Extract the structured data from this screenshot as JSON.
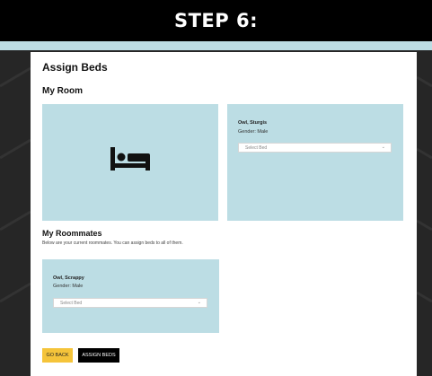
{
  "banner": {
    "title": "STEP 6:"
  },
  "page": {
    "title": "Assign Beds",
    "my_room_label": "My Room"
  },
  "my_room": {
    "bed_icon": "bed-icon",
    "occupant": {
      "name": "Owl, Sturgis",
      "gender": "Gender: Male",
      "select_value": "Select Bed"
    }
  },
  "roommates": {
    "title": "My Roommates",
    "description": "Below are your current roommates. You can assign beds to all of them.",
    "items": [
      {
        "name": "Owl, Scrappy",
        "gender": "Gender: Male",
        "select_value": "Select Bed"
      }
    ]
  },
  "actions": {
    "go_back": "GO BACK",
    "assign_beds": "ASSIGN BEDS"
  },
  "colors": {
    "banner_bg": "#000000",
    "accent_blue": "#bcdde4",
    "go_back_bg": "#f5c43a",
    "assign_bg": "#000000"
  }
}
